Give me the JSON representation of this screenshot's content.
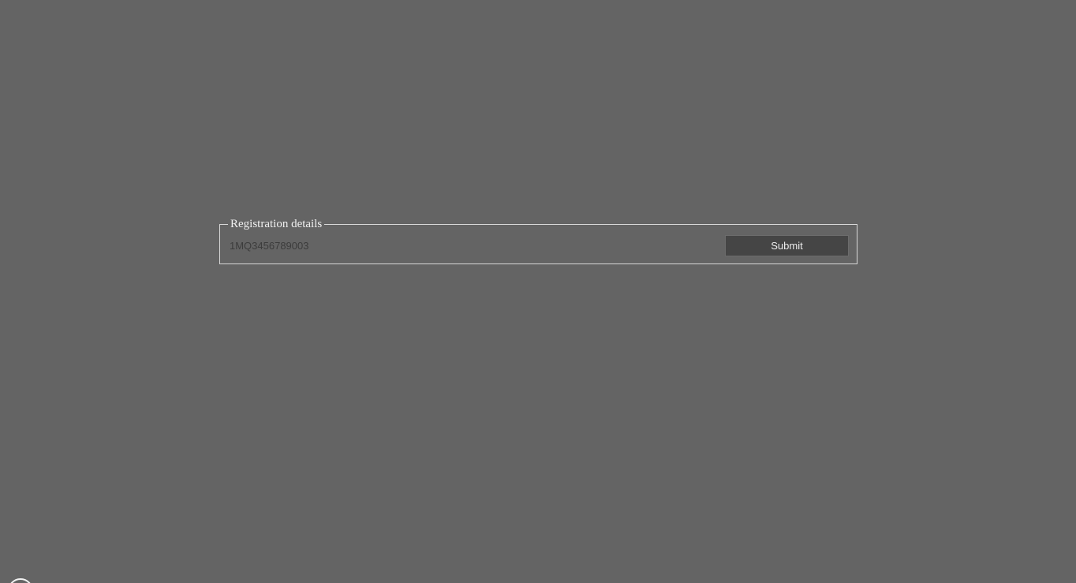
{
  "form": {
    "legend": "Registration details",
    "registration_value": "1MQ3456789003",
    "submit_label": "Submit"
  },
  "icons": {
    "corner": "start-orb-icon"
  },
  "colors": {
    "background": "#646464",
    "button_background": "#454545",
    "border": "#d8d8d8"
  }
}
